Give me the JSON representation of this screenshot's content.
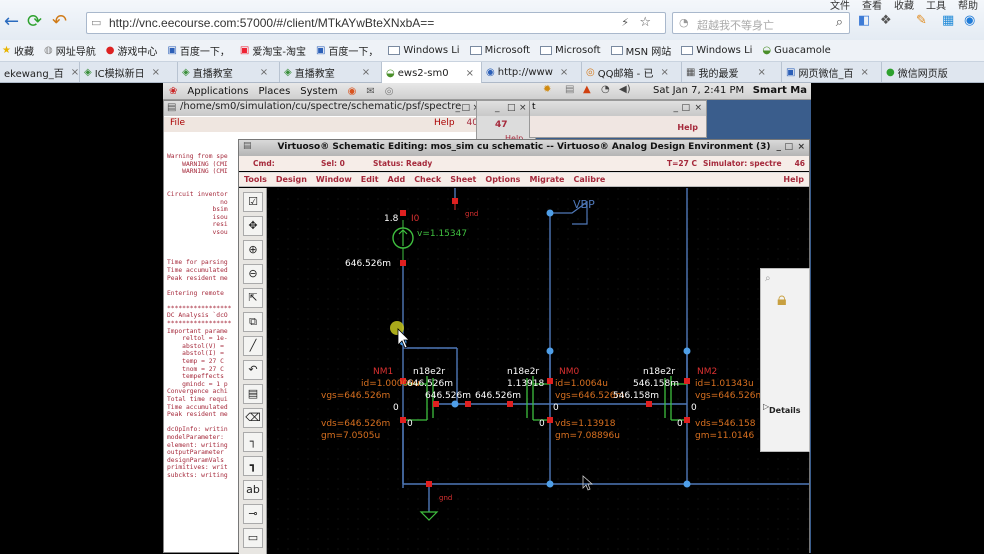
{
  "browser": {
    "menu": [
      "文件",
      "查看",
      "收藏",
      "工具",
      "帮助"
    ],
    "url": "http://vnc.eecourse.com:57000/#/client/MTkAYwBteXNxbA==",
    "search_placeholder": "超越我不等身亡",
    "bookmarks": [
      "收藏",
      "网址导航",
      "游戏中心",
      "百度一下，",
      "爱淘宝-淘宝",
      "百度一下，",
      "Windows Li",
      "Microsoft",
      "Microsoft",
      "MSN 网站",
      "Windows Li",
      "Guacamole"
    ],
    "tabs": [
      {
        "label": "ekewang_百",
        "active": false
      },
      {
        "label": "IC模拟新日",
        "active": false
      },
      {
        "label": "直播教室",
        "active": false
      },
      {
        "label": "直播教室",
        "active": false
      },
      {
        "label": "ews2-sm0",
        "active": true
      },
      {
        "label": "http://www",
        "active": false
      },
      {
        "label": "QQ邮箱 - 已",
        "active": false
      },
      {
        "label": "我的最爱",
        "active": false
      },
      {
        "label": "网页微信_百",
        "active": false
      },
      {
        "label": "微信网页版",
        "active": false
      }
    ]
  },
  "gnome": {
    "applications": "Applications",
    "places": "Places",
    "system": "System",
    "clock": "Sat Jan  7,  2:41 PM",
    "user": "Smart Ma"
  },
  "log_window": {
    "title": "/home/sm0/simulation/cu/spectre/schematic/psf/spectre",
    "file": "File",
    "help": "Help",
    "num": "40",
    "lines": [
      "Warning from spe",
      "    WARNING (CMI",
      "    WARNING (CMI",
      "",
      "",
      "Circuit inventor",
      "              no",
      "            bsim",
      "            isou",
      "            resi",
      "            vsou",
      "",
      "",
      "",
      "Time for parsing",
      "Time accumulated",
      "Peak resident me",
      "",
      "Entering remote ",
      "",
      "*****************",
      "DC Analysis `dcO",
      "*****************",
      "Important parame",
      "    reltol = 1e-",
      "    abstol(V) = ",
      "    abstol(I) = ",
      "    temp = 27 C",
      "    tnom = 27 C",
      "    tempeffects ",
      "    gmindc = 1 p",
      "Convergence achi",
      "Total time requi",
      "Time accumulated",
      "Peak resident me",
      "",
      "dcOpInfo: writin",
      "modelParameter: ",
      "element: writing",
      "outputParameter ",
      "designParamVals ",
      "primitives: writ",
      "subckts: writing"
    ]
  },
  "mid_window": {
    "num": "47",
    "help": "Help"
  },
  "right_window": {
    "help": "Help",
    "letter": "t"
  },
  "schematic": {
    "title": "Virtuoso® Schematic Editing: mos_sim cu schematic -- Virtuoso® Analog Design Environment (3)",
    "cmd": "Cmd:",
    "sel": "Sel: 0",
    "status": "Status: Ready",
    "temp": "T=27  C",
    "simulator": "Simulator: spectre",
    "num": "46",
    "menus": [
      "Tools",
      "Design",
      "Window",
      "Edit",
      "Add",
      "Check",
      "Sheet",
      "Options",
      "Migrate",
      "Calibre"
    ],
    "help": "Help",
    "labels": {
      "vsrc_val": "1.8",
      "vsrc_name": "I0",
      "vsrc_v": "v=1.15347",
      "gnd_top": "gnd",
      "node_top": "646.526m",
      "vbp": "VBP",
      "nm1_name": "NM1",
      "nm1_id": "id=1.00009u",
      "nm1_vgs": "vgs=646.526m",
      "nm1_vds": "vds=646.526m",
      "nm1_gm": "gm=7.0505u",
      "nm1_node": "646.526m",
      "nm1_model": "n18e2r",
      "mid_node1": "646.526m",
      "mid_node2": "646.526m",
      "nm0_name": "NM0",
      "nm0_model": "n18e2r",
      "nm0_v": "1.13918",
      "nm0_id": "id=1.0064u",
      "nm0_vgs": "vgs=646.526m",
      "nm0_vds": "vds=1.13918",
      "nm0_gm": "gm=7.08896u",
      "nm2_name": "NM2",
      "nm2_model": "n18e2r",
      "nm2_v": "546.158m",
      "nm2_id": "id=1.01343u",
      "nm2_vgs": "vgs=646.526m",
      "nm2_vds": "vds=546.158",
      "nm2_gm": "gm=11.0146",
      "nm2_node": "546.158m",
      "zero": "0",
      "gnd_bot": "gnd"
    }
  },
  "popup": {
    "details": "Details"
  }
}
